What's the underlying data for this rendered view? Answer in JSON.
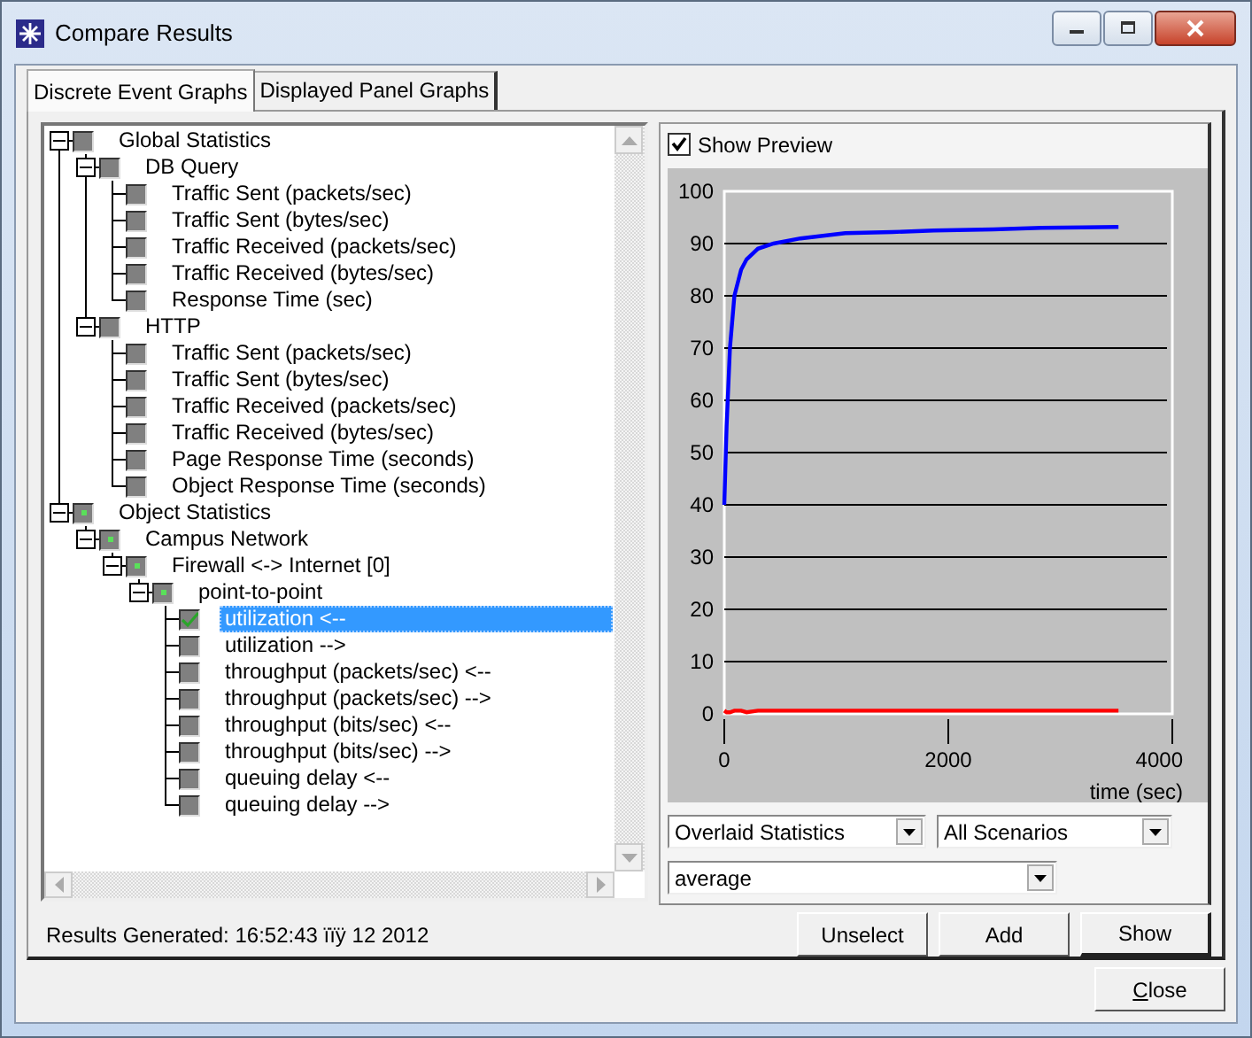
{
  "window": {
    "title": "Compare Results"
  },
  "tabs": [
    {
      "label": "Discrete Event Graphs",
      "selected": true
    },
    {
      "label": "Displayed Panel Graphs",
      "selected": false
    }
  ],
  "tree": [
    {
      "label": "Global Statistics",
      "expanded": true,
      "checked": false,
      "selected": false,
      "children": [
        {
          "label": "DB Query",
          "expanded": true,
          "checked": false,
          "selected": false,
          "children": [
            {
              "label": "Traffic Sent (packets/sec)",
              "checked": false,
              "selected": false
            },
            {
              "label": "Traffic Sent (bytes/sec)",
              "checked": false,
              "selected": false
            },
            {
              "label": "Traffic Received (packets/sec)",
              "checked": false,
              "selected": false
            },
            {
              "label": "Traffic Received (bytes/sec)",
              "checked": false,
              "selected": false
            },
            {
              "label": "Response Time (sec)",
              "checked": false,
              "selected": false
            }
          ]
        },
        {
          "label": "HTTP",
          "expanded": true,
          "checked": false,
          "selected": false,
          "children": [
            {
              "label": "Traffic Sent (packets/sec)",
              "checked": false,
              "selected": false
            },
            {
              "label": "Traffic Sent (bytes/sec)",
              "checked": false,
              "selected": false
            },
            {
              "label": "Traffic Received (packets/sec)",
              "checked": false,
              "selected": false
            },
            {
              "label": "Traffic Received (bytes/sec)",
              "checked": false,
              "selected": false
            },
            {
              "label": "Page Response Time (seconds)",
              "checked": false,
              "selected": false
            },
            {
              "label": "Object Response Time (seconds)",
              "checked": false,
              "selected": false
            }
          ]
        }
      ]
    },
    {
      "label": "Object Statistics",
      "expanded": true,
      "checked": true,
      "selected": false,
      "children": [
        {
          "label": "Campus Network",
          "expanded": true,
          "checked": true,
          "selected": false,
          "children": [
            {
              "label": "Firewall <-> Internet [0]",
              "expanded": true,
              "checked": true,
              "selected": false,
              "children": [
                {
                  "label": "point-to-point",
                  "expanded": true,
                  "checked": true,
                  "selected": false,
                  "children": [
                    {
                      "label": "utilization <--",
                      "checked": true,
                      "selected": true
                    },
                    {
                      "label": "utilization -->",
                      "checked": false,
                      "selected": false
                    },
                    {
                      "label": "throughput (packets/sec) <--",
                      "checked": false,
                      "selected": false
                    },
                    {
                      "label": "throughput (packets/sec) -->",
                      "checked": false,
                      "selected": false
                    },
                    {
                      "label": "throughput (bits/sec) <--",
                      "checked": false,
                      "selected": false
                    },
                    {
                      "label": "throughput (bits/sec) -->",
                      "checked": false,
                      "selected": false
                    },
                    {
                      "label": "queuing delay <--",
                      "checked": false,
                      "selected": false
                    },
                    {
                      "label": "queuing delay -->",
                      "checked": false,
                      "selected": false
                    }
                  ]
                }
              ]
            }
          ]
        }
      ]
    }
  ],
  "preview": {
    "label": "Show Preview",
    "checked": true
  },
  "chart_data": {
    "type": "line",
    "xlabel": "time (sec)",
    "x": [
      0,
      20,
      50,
      90,
      150,
      200,
      300,
      440,
      680,
      1080,
      1500,
      1870,
      2400,
      2830,
      3200,
      3520
    ],
    "series": [
      {
        "color": "#0000ff",
        "values": [
          40,
          55,
          70,
          80,
          85,
          87,
          89,
          90,
          91,
          92,
          92.2,
          92.5,
          92.7,
          93,
          93.1,
          93.2
        ]
      },
      {
        "color": "#ff0000",
        "values": [
          0.6,
          0.3,
          0.3,
          0.6,
          0.6,
          0.3,
          0.6,
          0.6,
          0.6,
          0.6,
          0.6,
          0.6,
          0.6,
          0.6,
          0.6,
          0.6
        ]
      }
    ],
    "grid": true,
    "xlim": [
      0,
      4000
    ],
    "ylim": [
      0,
      100
    ],
    "xticks": [
      0,
      2000,
      4000
    ],
    "yticks": [
      0,
      10,
      20,
      30,
      40,
      50,
      60,
      70,
      80,
      90,
      100
    ]
  },
  "dropdowns": [
    {
      "value": "Overlaid Statistics"
    },
    {
      "value": "All Scenarios"
    },
    {
      "value": "average"
    }
  ],
  "status": "Results Generated: 16:52:43 ïïÿ 12 2012",
  "buttons": [
    {
      "label": "Unselect"
    },
    {
      "label": "Add"
    },
    {
      "label": "Show"
    }
  ],
  "close_button": {
    "label": "Close"
  }
}
